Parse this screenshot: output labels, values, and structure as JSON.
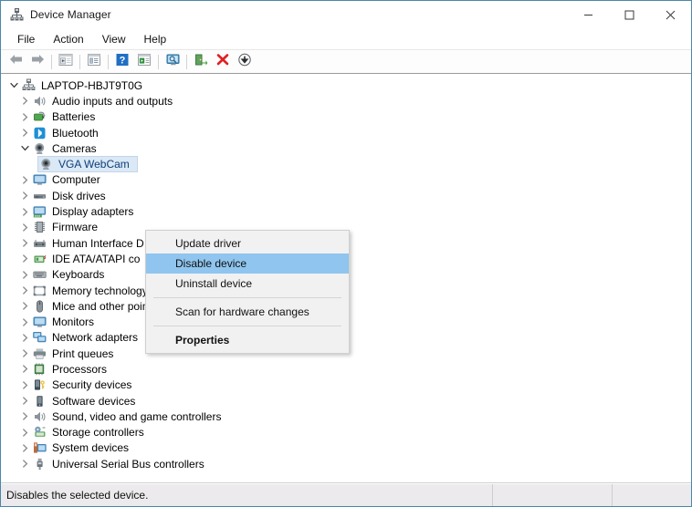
{
  "window": {
    "title": "Device Manager",
    "icon": "device-manager-icon",
    "controls": {
      "minimize": "minimize-button",
      "maximize": "maximize-button",
      "close": "close-button"
    }
  },
  "menubar": {
    "items": [
      {
        "label": "File",
        "name": "menu-file"
      },
      {
        "label": "Action",
        "name": "menu-action"
      },
      {
        "label": "View",
        "name": "menu-view"
      },
      {
        "label": "Help",
        "name": "menu-help"
      }
    ]
  },
  "toolbar": {
    "buttons": [
      {
        "name": "back-button",
        "icon": "back-arrow-icon"
      },
      {
        "name": "forward-button",
        "icon": "forward-arrow-icon"
      },
      {
        "name": "show-hide-console-tree-button",
        "icon": "console-tree-icon"
      },
      {
        "name": "properties-button",
        "icon": "properties-window-icon"
      },
      {
        "name": "help-button",
        "icon": "question-mark-icon"
      },
      {
        "name": "details-button",
        "icon": "details-pane-icon"
      },
      {
        "name": "scan-hardware-changes-button",
        "icon": "monitor-scan-icon"
      },
      {
        "name": "update-driver-button",
        "icon": "update-driver-icon"
      },
      {
        "name": "uninstall-device-button",
        "icon": "red-x-icon"
      },
      {
        "name": "disable-device-button",
        "icon": "down-arrow-circle-icon"
      }
    ]
  },
  "tree": {
    "root": {
      "label": "LAPTOP-HBJT9T0G",
      "icon": "computer-root-icon",
      "expanded": true
    },
    "nodes": [
      {
        "label": "Audio inputs and outputs",
        "icon": "speaker-icon",
        "level": 1,
        "expanded": false
      },
      {
        "label": "Batteries",
        "icon": "battery-icon",
        "level": 1,
        "expanded": false
      },
      {
        "label": "Bluetooth",
        "icon": "bluetooth-icon",
        "level": 1,
        "expanded": false
      },
      {
        "label": "Cameras",
        "icon": "camera-icon",
        "level": 1,
        "expanded": true
      },
      {
        "label": "VGA WebCam",
        "icon": "camera-icon",
        "level": 2,
        "selected": true
      },
      {
        "label": "Computer",
        "icon": "monitor-icon",
        "level": 1,
        "expanded": false
      },
      {
        "label": "Disk drives",
        "icon": "disk-drive-icon",
        "level": 1,
        "expanded": false
      },
      {
        "label": "Display adapters",
        "icon": "display-adapter-icon",
        "level": 1,
        "expanded": false
      },
      {
        "label": "Firmware",
        "icon": "firmware-icon",
        "level": 1,
        "expanded": false
      },
      {
        "label": "Human Interface D",
        "icon": "hid-icon",
        "level": 1,
        "expanded": false
      },
      {
        "label": "IDE ATA/ATAPI co",
        "icon": "ide-controller-icon",
        "level": 1,
        "expanded": false
      },
      {
        "label": "Keyboards",
        "icon": "keyboard-icon",
        "level": 1,
        "expanded": false
      },
      {
        "label": "Memory technology devices",
        "icon": "memory-device-icon",
        "level": 1,
        "expanded": false
      },
      {
        "label": "Mice and other pointing devices",
        "icon": "mouse-icon",
        "level": 1,
        "expanded": false
      },
      {
        "label": "Monitors",
        "icon": "monitor-icon",
        "level": 1,
        "expanded": false
      },
      {
        "label": "Network adapters",
        "icon": "network-adapter-icon",
        "level": 1,
        "expanded": false
      },
      {
        "label": "Print queues",
        "icon": "printer-icon",
        "level": 1,
        "expanded": false
      },
      {
        "label": "Processors",
        "icon": "processor-icon",
        "level": 1,
        "expanded": false
      },
      {
        "label": "Security devices",
        "icon": "security-device-icon",
        "level": 1,
        "expanded": false
      },
      {
        "label": "Software devices",
        "icon": "software-device-icon",
        "level": 1,
        "expanded": false
      },
      {
        "label": "Sound, video and game controllers",
        "icon": "speaker-icon",
        "level": 1,
        "expanded": false
      },
      {
        "label": "Storage controllers",
        "icon": "storage-controller-icon",
        "level": 1,
        "expanded": false
      },
      {
        "label": "System devices",
        "icon": "system-device-icon",
        "level": 1,
        "expanded": false
      },
      {
        "label": "Universal Serial Bus controllers",
        "icon": "usb-icon",
        "level": 1,
        "expanded": false
      }
    ]
  },
  "context_menu": {
    "items": [
      {
        "label": "Update driver",
        "name": "ctx-update-driver",
        "highlighted": false,
        "bold": false
      },
      {
        "label": "Disable device",
        "name": "ctx-disable-device",
        "highlighted": true,
        "bold": false
      },
      {
        "label": "Uninstall device",
        "name": "ctx-uninstall-device",
        "highlighted": false,
        "bold": false
      },
      {
        "label": "Scan for hardware changes",
        "name": "ctx-scan-hardware-changes",
        "highlighted": false,
        "bold": false
      },
      {
        "label": "Properties",
        "name": "ctx-properties",
        "highlighted": false,
        "bold": true
      }
    ]
  },
  "statusbar": {
    "message": "Disables the selected device.",
    "panel2": "",
    "panel3": ""
  },
  "colors": {
    "window_border": "#4a88a8",
    "selection_blue": "#dbe8f5",
    "menu_highlight": "#8fc5ee",
    "accent_red": "#e02020",
    "accent_green": "#3d8a3d",
    "bluetooth_blue": "#1f8fd6"
  }
}
